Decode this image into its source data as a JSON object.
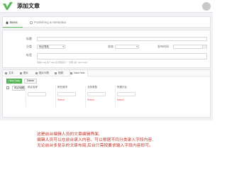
{
  "header": {
    "title": "添加文章",
    "brand_color": "#5cb85c"
  },
  "tabs": [
    {
      "label": "Basic",
      "icon": "home-icon",
      "active": true
    },
    {
      "label": "Publishing & Metadata",
      "icon": "gear-icon",
      "active": false
    }
  ],
  "form": {
    "title_label": "标题",
    "category_label": "分类",
    "category_value": "网点导航",
    "status_label": "状态",
    "date_label": "发布时间",
    "tags_label": "标签",
    "tags_hint": "请输入tag,多个tags之间用英文 \",\" 分隔 (如: tag1,tag2)"
  },
  "editor": {
    "tool_tabs": [
      {
        "label": "文本",
        "icon": "text-icon"
      },
      {
        "label": "图片",
        "icon": "image-icon"
      },
      {
        "label": "图片列表",
        "icon": "gallery-icon"
      },
      {
        "label": "视频",
        "icon": "video-icon"
      },
      {
        "label": "Data Sets",
        "icon": "table-icon",
        "active": true
      }
    ],
    "new_set_label": "New Data Set",
    "delete_label": "Delete",
    "row_select_value": "网点地图",
    "columns": [
      {
        "header": "网点名称"
      },
      {
        "header": "所在城市",
        "select": "Select"
      },
      {
        "header": "业务类型",
        "select": "Select"
      },
      {
        "header": "所属行业",
        "select": "Select"
      }
    ]
  },
  "annotation": {
    "lines": [
      "这是前台编辑人员的文章编辑界面,",
      "编辑人员可以在前台录入内容。可以根据不同分类录入字段内容,",
      "无论前台多复杂的文章布局,后台只需按要求输入字段内容即可。"
    ],
    "color": "#c0392b"
  }
}
